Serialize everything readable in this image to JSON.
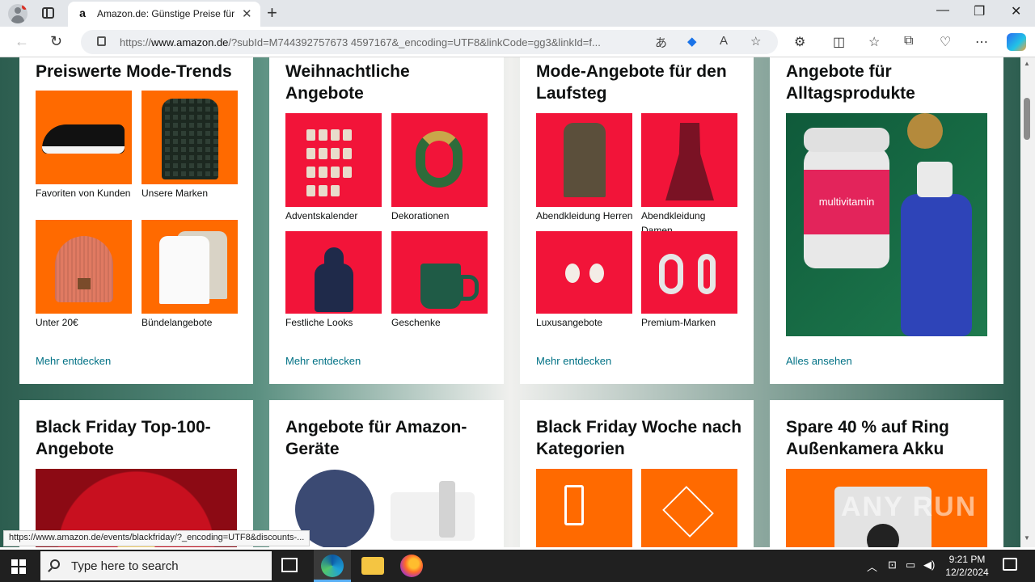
{
  "browser": {
    "tab_title": "Amazon.de: Günstige Preise für E",
    "tab_favicon": "a",
    "url_prefix": "https://",
    "url_domain": "www.amazon.de",
    "url_rest": "/?subId=M744392757673 4597167&_encoding=UTF8&linkCode=gg3&linkId=f...",
    "status_url": "https://www.amazon.de/events/blackfriday/?_encoding=UTF8&discounts-..."
  },
  "cards_row1": [
    {
      "title": "Preiswerte Mode-Trends",
      "tiles": [
        "Favoriten von Kunden",
        "Unsere Marken",
        "Unter 20€",
        "Bündelangebote"
      ],
      "more": "Mehr entdecken"
    },
    {
      "title": "Weihnachtliche Angebote",
      "tiles": [
        "Adventskalender",
        "Dekorationen",
        "Festliche Looks",
        "Geschenke"
      ],
      "more": "Mehr entdecken"
    },
    {
      "title": "Mode-Angebote für den Laufsteg",
      "tiles": [
        "Abendkleidung Herren",
        "Abendkleidung Damen",
        "Luxusangebote",
        "Premium-Marken"
      ],
      "more": "Mehr entdecken"
    },
    {
      "title": "Angebote für Alltagsprodukte",
      "image_label": "multivitamin",
      "more": "Alles ansehen"
    }
  ],
  "cards_row2": [
    {
      "title": "Black Friday Top-100-Angebote"
    },
    {
      "title": "Angebote für Amazon-Geräte"
    },
    {
      "title": "Black Friday Woche nach Kategorien"
    },
    {
      "title": "Spare 40 % auf Ring Außenkamera Akku"
    }
  ],
  "watermark": "ANY RUN",
  "taskbar": {
    "search_placeholder": "Type here to search",
    "time": "9:21 PM",
    "date": "12/2/2024"
  },
  "colors": {
    "link": "#007185",
    "tile_orange": "#ff6a00",
    "tile_red": "#f21439"
  }
}
